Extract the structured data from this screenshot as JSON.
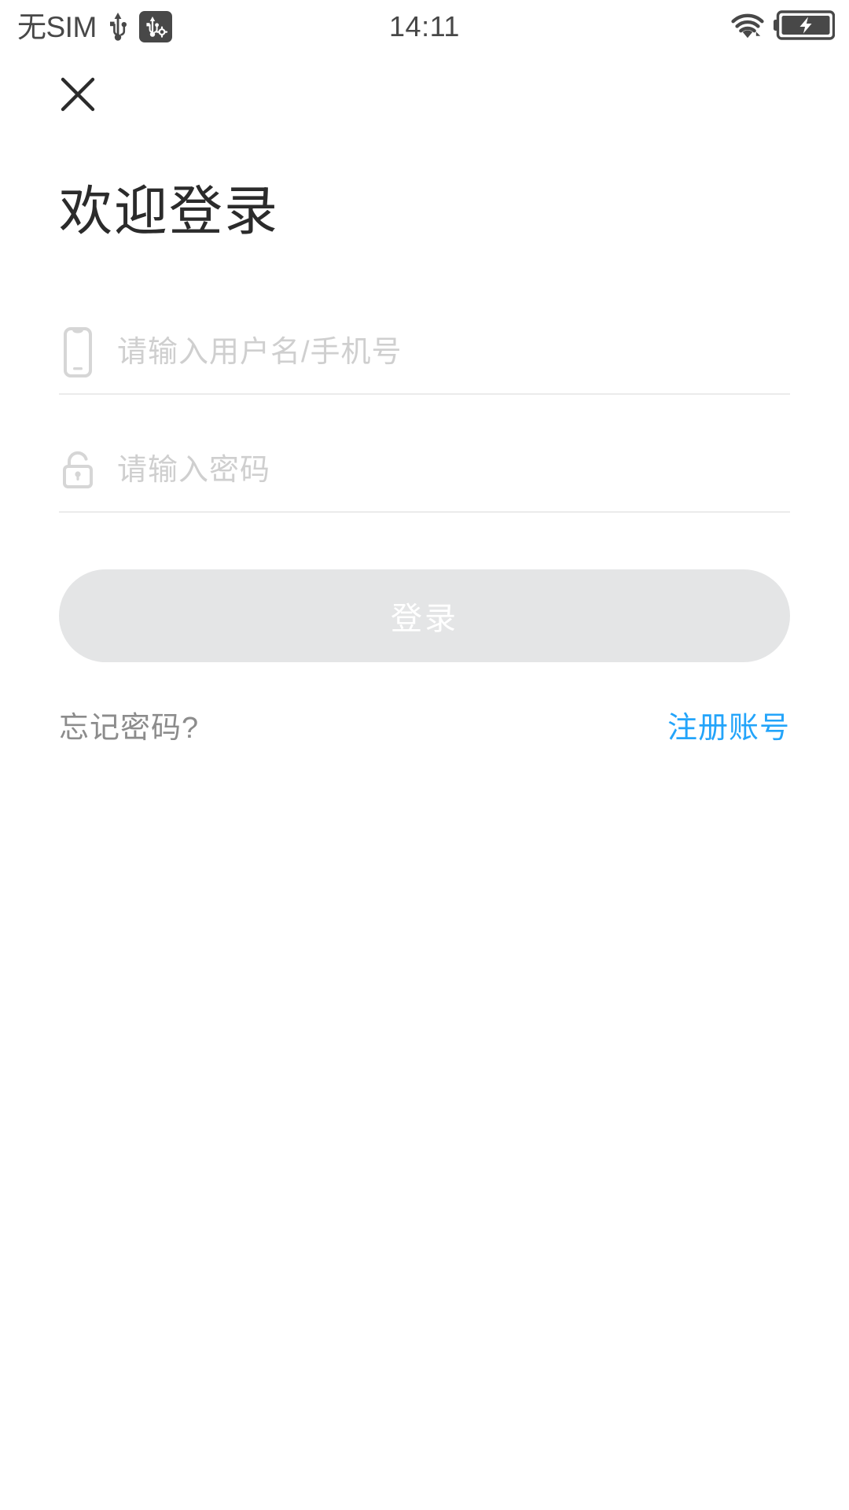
{
  "status_bar": {
    "carrier": "无SIM",
    "clock": "14:11",
    "icons": {
      "usb": "usb-icon",
      "usb_debug": "usb-debugging-icon",
      "wifi": "wifi-icon",
      "battery": "battery-charging-icon"
    },
    "colors": {
      "text": "#484848"
    }
  },
  "header": {
    "close_icon": "close-icon",
    "title": "欢迎登录"
  },
  "form": {
    "username": {
      "icon": "phone-icon",
      "value": "",
      "placeholder": "请输入用户名/手机号"
    },
    "password": {
      "icon": "unlock-icon",
      "value": "",
      "placeholder": "请输入密码"
    },
    "submit_label": "登录",
    "submit_enabled": false
  },
  "links": {
    "forgot_password": "忘记密码?",
    "register": "注册账号"
  },
  "colors": {
    "accent_blue": "#23a4fa",
    "muted_text": "#8c8c8c",
    "placeholder": "#cfcfcf",
    "divider": "#ebebeb",
    "button_disabled": "#e4e5e6",
    "title": "#2b2b2b",
    "background": "#ffffff"
  }
}
